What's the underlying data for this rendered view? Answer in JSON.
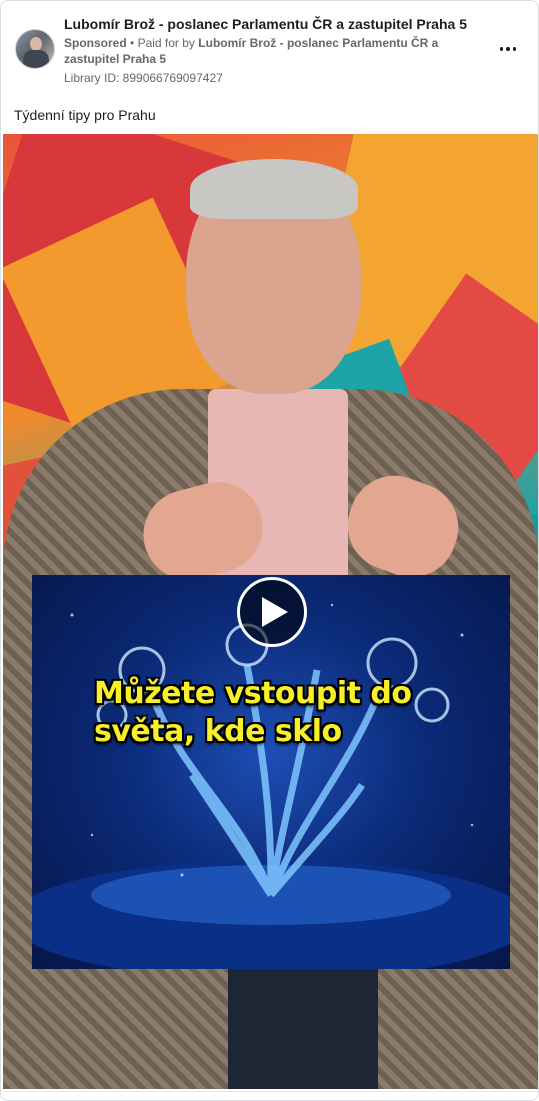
{
  "ad": {
    "page_name": "Lubomír Brož - poslanec Parlamentu ČR a zastupitel Praha 5",
    "sponsored_label": "Sponsored",
    "separator": "•",
    "paid_for_prefix": "Paid for by",
    "paid_for_name": "Lubomír Brož - poslanec Parlamentu ČR a zastupitel Praha 5",
    "library_id": "Library ID: 899066769097427",
    "post_text": "Týdenní tipy pro Prahu"
  },
  "video": {
    "caption": "Můžete vstoupit do světa, kde sklo",
    "play_icon": "play-icon"
  },
  "icons": {
    "more": "more-options-icon",
    "avatar": "profile-picture"
  },
  "colors": {
    "caption_text": "#f6ef2a",
    "secondary_text": "#65676b",
    "primary_text": "#1c1e21"
  }
}
